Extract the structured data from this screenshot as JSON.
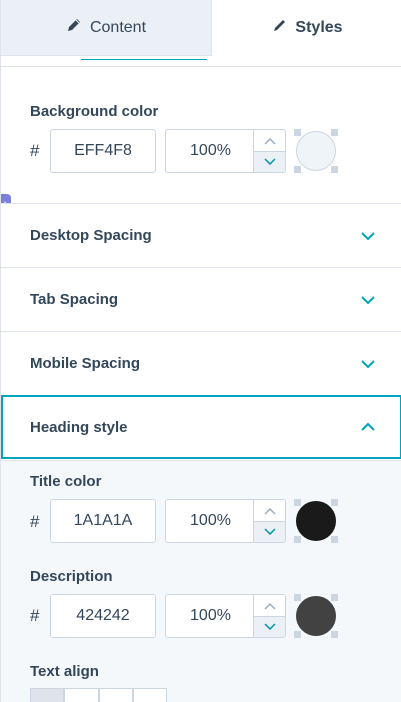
{
  "tabs": {
    "content_label": "Content",
    "styles_label": "Styles"
  },
  "background": {
    "label": "Background color",
    "hash": "#",
    "hex": "EFF4F8",
    "opacity": "100%",
    "swatch_color": "#EFF4F8"
  },
  "sections": {
    "desktop": "Desktop Spacing",
    "tab": "Tab Spacing",
    "mobile": "Mobile Spacing",
    "heading": "Heading style"
  },
  "heading_style": {
    "title_color": {
      "label": "Title color",
      "hash": "#",
      "hex": "1A1A1A",
      "opacity": "100%",
      "swatch_color": "#1A1A1A"
    },
    "description": {
      "label": "Description",
      "hash": "#",
      "hex": "424242",
      "opacity": "100%",
      "swatch_color": "#424242"
    },
    "text_align": {
      "label": "Text align"
    }
  },
  "icons": {
    "content_tab": "pencil-icon",
    "styles_tab": "brush-icon",
    "collapsed": "chevron-down-icon",
    "expanded": "chevron-up-icon",
    "stepper_up": "caret-up-icon",
    "stepper_down": "caret-down-icon"
  },
  "colors": {
    "accent": "#00a4bd",
    "text": "#33475b",
    "border": "#cbd6e2",
    "panel_tint": "#f5f8fa"
  }
}
